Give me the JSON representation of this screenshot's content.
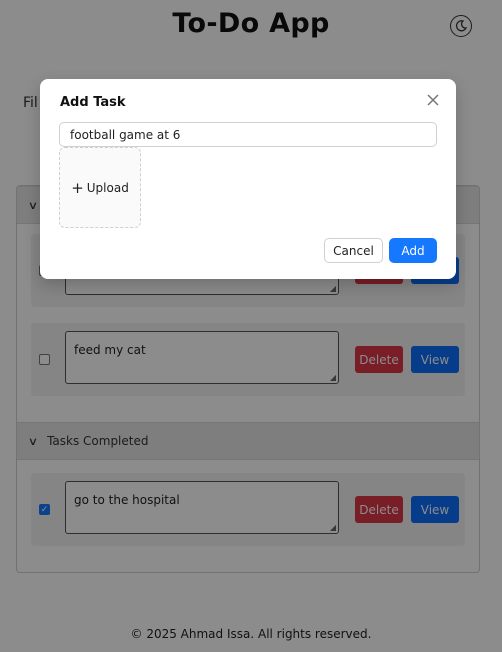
{
  "app": {
    "title": "To-Do App"
  },
  "filter": {
    "label": "Fil"
  },
  "sections": {
    "pending_label": "",
    "completed_label": "Tasks Completed"
  },
  "tasks": [
    {
      "text": "",
      "checked": false,
      "delete_label": "Delete",
      "view_label": "View"
    },
    {
      "text": "feed my cat",
      "checked": false,
      "delete_label": "Delete",
      "view_label": "View"
    },
    {
      "text": "go to the hospital",
      "checked": true,
      "delete_label": "Delete",
      "view_label": "View"
    }
  ],
  "modal": {
    "title": "Add Task",
    "input_value": "football game at 6",
    "upload_label": "Upload",
    "cancel_label": "Cancel",
    "add_label": "Add"
  },
  "footer": {
    "text": "© 2025 Ahmad Issa. All rights reserved."
  },
  "colors": {
    "primary": "#1677ff",
    "view": "#0d6efd",
    "danger": "#dc3545"
  },
  "icons": {
    "theme": "moon-icon",
    "close": "close-icon",
    "chevron": "chevron-down-icon",
    "upload": "plus-icon"
  }
}
